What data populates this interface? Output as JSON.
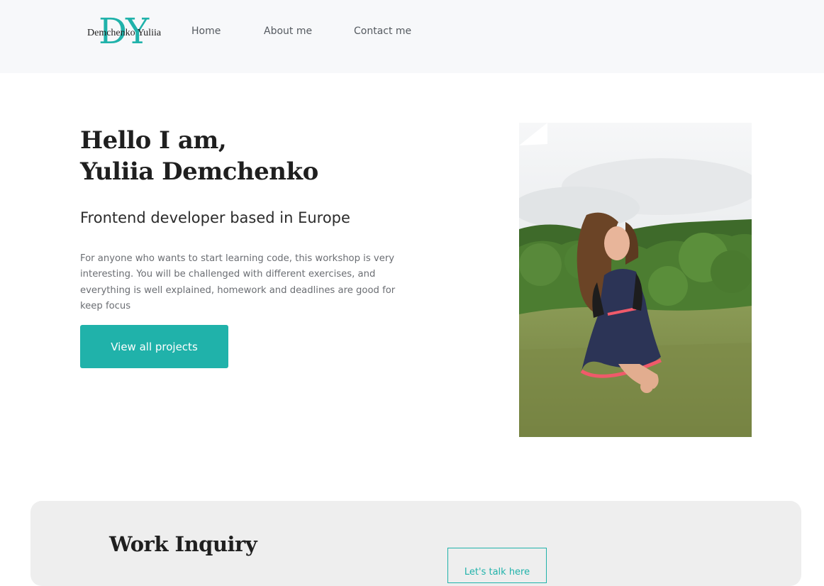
{
  "header": {
    "logo": {
      "monogram": "DY",
      "name": "Demchenko Yuliia"
    },
    "nav": [
      {
        "label": "Home"
      },
      {
        "label": "About me"
      },
      {
        "label": "Contact me"
      }
    ]
  },
  "hero": {
    "title_line1": "Hello I am,",
    "title_line2": "Yuliia Demchenko",
    "subtitle": "Frontend developer based in Europe",
    "description": "For anyone who wants to start learning code, this workshop is very interesting. You will be challenged with different exercises, and everything is well explained, homework and deadlines are good for keep focus",
    "cta_label": "View all projects"
  },
  "inquiry": {
    "title": "Work Inquiry",
    "button_label": "Let's talk here"
  },
  "colors": {
    "accent": "#20b2aa",
    "header_bg": "#f7f8fa",
    "inquiry_bg": "#eeeeee"
  }
}
